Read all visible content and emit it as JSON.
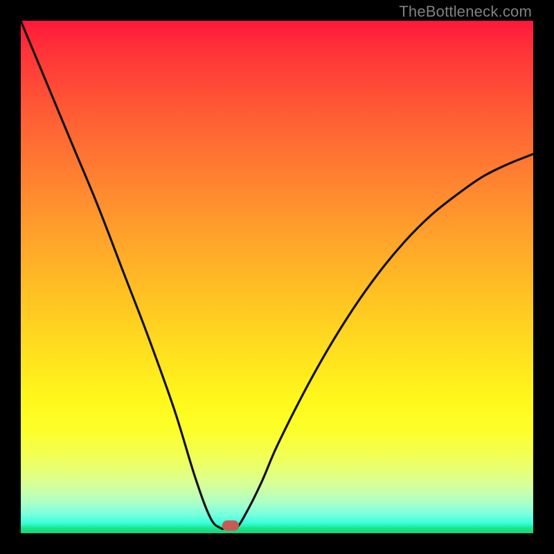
{
  "watermark": "TheBottleneck.com",
  "colors": {
    "frame": "#000000",
    "curve": "#111111",
    "marker": "#c85a54",
    "watermark": "#818181"
  },
  "chart_data": {
    "type": "line",
    "title": "",
    "xlabel": "",
    "ylabel": "",
    "xlim": [
      0,
      100
    ],
    "ylim": [
      0,
      100
    ],
    "grid": false,
    "legend": false,
    "annotations": [],
    "marker": {
      "x": 41,
      "y": 1.5,
      "shape": "rounded-rect"
    },
    "series": [
      {
        "name": "bottleneck-curve",
        "x": [
          0,
          5,
          10,
          15,
          20,
          25,
          30,
          34,
          37,
          39,
          40,
          42,
          44,
          47,
          50,
          55,
          60,
          65,
          70,
          75,
          80,
          85,
          90,
          95,
          100
        ],
        "y": [
          100,
          88,
          76,
          64,
          51,
          38,
          24,
          11,
          3,
          1,
          1,
          1,
          4,
          10,
          17,
          27,
          36,
          44,
          51,
          57,
          62,
          66,
          69.5,
          72,
          74
        ]
      }
    ],
    "background_gradient": {
      "direction": "vertical",
      "stops": [
        {
          "pos": 0.0,
          "color": "#ff183b"
        },
        {
          "pos": 0.06,
          "color": "#ff3339"
        },
        {
          "pos": 0.18,
          "color": "#ff5c35"
        },
        {
          "pos": 0.3,
          "color": "#ff7f31"
        },
        {
          "pos": 0.42,
          "color": "#ffa22b"
        },
        {
          "pos": 0.54,
          "color": "#ffc323"
        },
        {
          "pos": 0.66,
          "color": "#ffe31e"
        },
        {
          "pos": 0.74,
          "color": "#fff81c"
        },
        {
          "pos": 0.8,
          "color": "#fdff2a"
        },
        {
          "pos": 0.85,
          "color": "#f2ff56"
        },
        {
          "pos": 0.89,
          "color": "#e0ff85"
        },
        {
          "pos": 0.92,
          "color": "#c7ffae"
        },
        {
          "pos": 0.945,
          "color": "#a2ffce"
        },
        {
          "pos": 0.965,
          "color": "#73ffe0"
        },
        {
          "pos": 0.98,
          "color": "#3affdb"
        },
        {
          "pos": 0.99,
          "color": "#18e58f"
        },
        {
          "pos": 1.0,
          "color": "#1bd473"
        }
      ]
    }
  }
}
